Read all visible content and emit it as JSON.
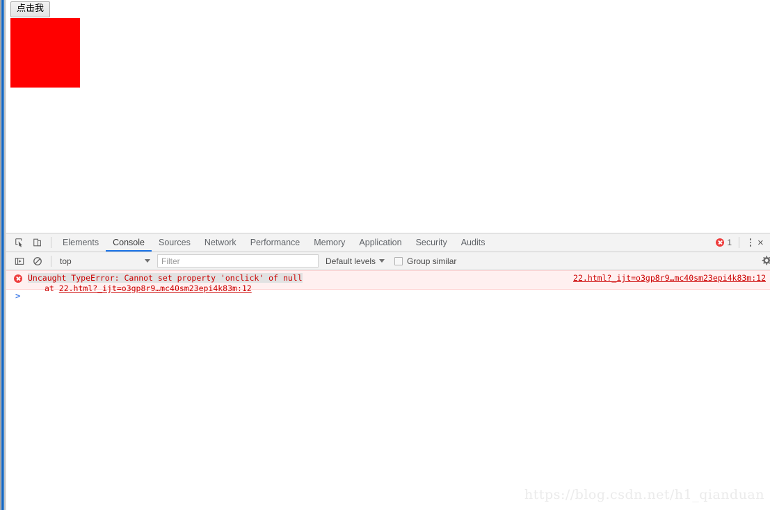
{
  "page": {
    "button_label": "点击我",
    "red_box_color": "#ff0000"
  },
  "devtools": {
    "tabs": [
      {
        "label": "Elements",
        "active": false
      },
      {
        "label": "Console",
        "active": true
      },
      {
        "label": "Sources",
        "active": false
      },
      {
        "label": "Network",
        "active": false
      },
      {
        "label": "Performance",
        "active": false
      },
      {
        "label": "Memory",
        "active": false
      },
      {
        "label": "Application",
        "active": false
      },
      {
        "label": "Security",
        "active": false
      },
      {
        "label": "Audits",
        "active": false
      }
    ],
    "icons": {
      "inspect": "inspect-element-icon",
      "device": "device-toolbar-icon",
      "sidebar": "console-sidebar-icon",
      "clear": "clear-console-icon",
      "kebab": "more-options-icon",
      "close": "close-devtools-icon",
      "gear": "settings-gear-icon"
    },
    "error_count": "1",
    "close_label": "×",
    "accent_color": "#1a73e8",
    "error_color": "#ee3d3d"
  },
  "console": {
    "context": "top",
    "filter_placeholder": "Filter",
    "filter_value": "",
    "levels_label": "Default levels",
    "group_similar_label": "Group similar",
    "group_similar_checked": false,
    "prompt_caret": ">",
    "messages": [
      {
        "type": "error",
        "text": "Uncaught TypeError: Cannot set property 'onclick' of null",
        "stack_prefix": "at ",
        "stack_link": "22.html?_ijt=o3gp8r9…mc40sm23epi4k83m:12",
        "source_link": "22.html?_ijt=o3gp8r9…mc40sm23epi4k83m:12"
      }
    ]
  },
  "watermark": {
    "text": "https://blog.csdn.net/h1_qianduan"
  }
}
